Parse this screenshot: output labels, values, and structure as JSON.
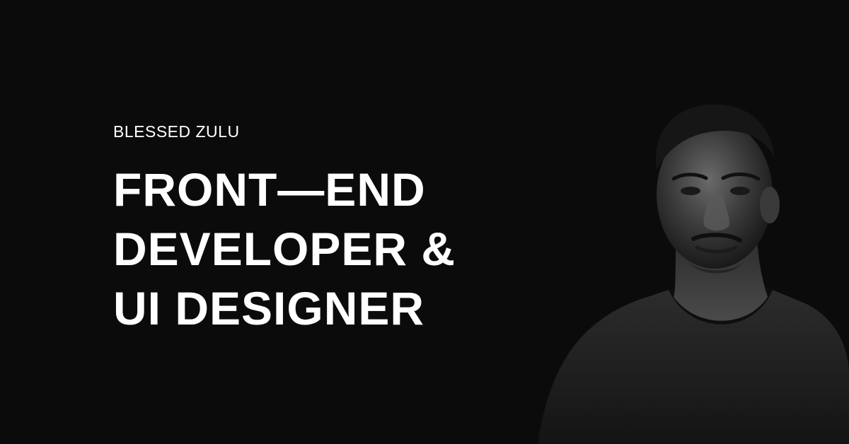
{
  "profile": {
    "name": "BLESSED ZULU",
    "headline_lines": [
      "FRONT—END",
      "DEVELOPER &",
      "UI DESIGNER"
    ]
  },
  "colors": {
    "background": "#0b0b0b",
    "text": "#ffffff"
  },
  "portrait": {
    "icon": "portrait-photo",
    "style": "black-and-white"
  }
}
